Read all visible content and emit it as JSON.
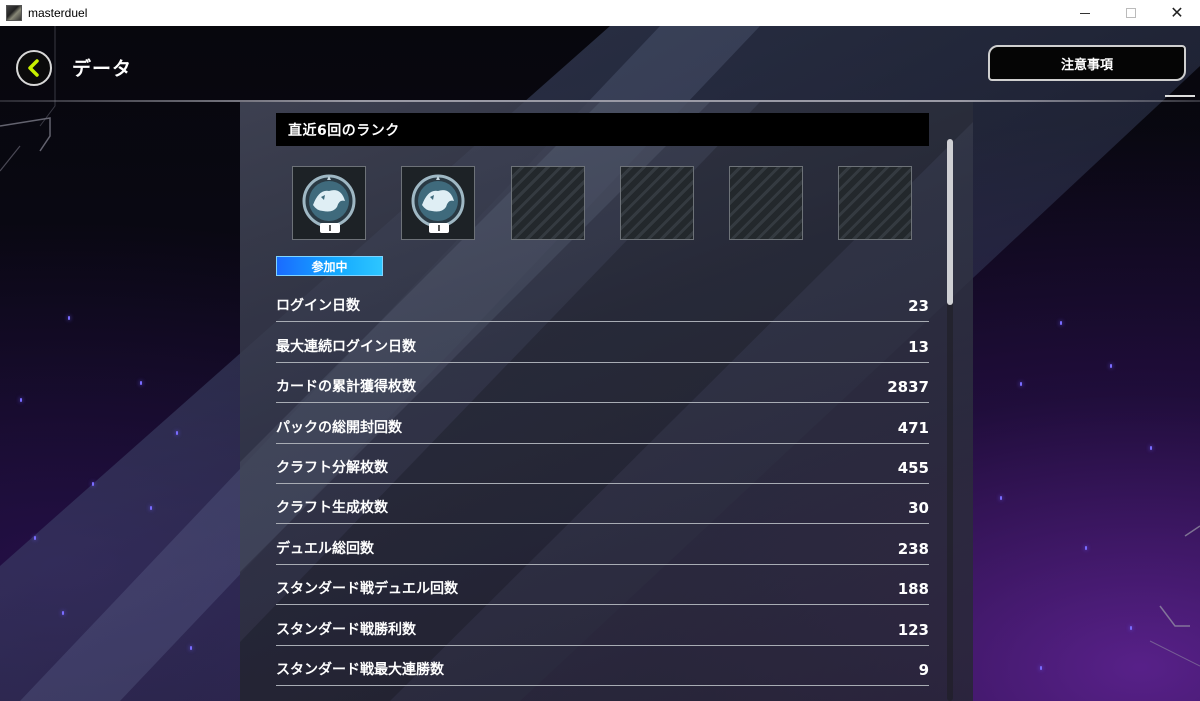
{
  "window": {
    "title": "masterduel",
    "controls": [
      "minimize",
      "maximize",
      "close"
    ]
  },
  "header": {
    "back_icon": "chevron-left-icon",
    "title": "データ",
    "notice_button": "注意事項"
  },
  "rank_section": {
    "title": "直近6回のランク",
    "slots": [
      {
        "state": "badge",
        "icon": "rank-badge-icon",
        "level": "Ⅰ"
      },
      {
        "state": "badge",
        "icon": "rank-badge-icon",
        "level": "Ⅰ"
      },
      {
        "state": "empty"
      },
      {
        "state": "empty"
      },
      {
        "state": "empty"
      },
      {
        "state": "empty"
      }
    ],
    "status": "参加中"
  },
  "stats": [
    {
      "label": "ログイン日数",
      "value": "23"
    },
    {
      "label": "最大連続ログイン日数",
      "value": "13"
    },
    {
      "label": "カードの累計獲得枚数",
      "value": "2837"
    },
    {
      "label": "パックの総開封回数",
      "value": "471"
    },
    {
      "label": "クラフト分解枚数",
      "value": "455"
    },
    {
      "label": "クラフト生成枚数",
      "value": "30"
    },
    {
      "label": "デュエル総回数",
      "value": "238"
    },
    {
      "label": "スタンダード戦デュエル回数",
      "value": "188"
    },
    {
      "label": "スタンダード戦勝利数",
      "value": "123"
    },
    {
      "label": "スタンダード戦最大連勝数",
      "value": "9"
    }
  ],
  "colors": {
    "accent_green": "#c8f000",
    "status_blue": "#14a8ff",
    "panel": "#464a5c"
  }
}
